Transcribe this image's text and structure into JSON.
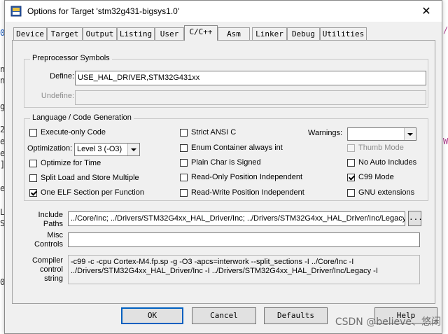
{
  "background_editor": {
    "fragments": [
      {
        "text": "0"
      },
      {
        "text": "ne"
      },
      {
        "text": "ns"
      },
      {
        "text": "g"
      },
      {
        "text": "2"
      },
      {
        "text": "e"
      },
      {
        "text": "e"
      },
      {
        "text": "]"
      },
      {
        "text": "e"
      },
      {
        "text": "L"
      },
      {
        "text": "S"
      },
      {
        "text": "0"
      },
      {
        "text": "/"
      },
      {
        "text": "W"
      }
    ]
  },
  "dialog": {
    "title": "Options for Target 'stm32g431-bigsys1.0'",
    "close_symbol": "✕",
    "accent_color": "#0060c0",
    "tabs": [
      "Device",
      "Target",
      "Output",
      "Listing",
      "User",
      "C/C++",
      "Asm",
      "Linker",
      "Debug",
      "Utilities"
    ],
    "active_tab": "C/C++"
  },
  "preprocessor": {
    "group_label": "Preprocessor Symbols",
    "define_label": "Define:",
    "define_value": "USE_HAL_DRIVER,STM32G431xx",
    "undefine_label": "Undefine:",
    "undefine_value": ""
  },
  "language": {
    "group_label": "Language / Code Generation",
    "execute_only": {
      "label": "Execute-only Code",
      "checked": false
    },
    "optimization_label": "Optimization:",
    "optimization_value": "Level 3 (-O3)",
    "optimize_time": {
      "label": "Optimize for Time",
      "checked": false
    },
    "split_load": {
      "label": "Split Load and Store Multiple",
      "checked": false
    },
    "one_elf": {
      "label": "One ELF Section per Function",
      "checked": true
    },
    "strict_ansi": {
      "label": "Strict ANSI C",
      "checked": false
    },
    "enum_container": {
      "label": "Enum Container always int",
      "checked": false
    },
    "plain_char": {
      "label": "Plain Char is Signed",
      "checked": false
    },
    "ro_pi": {
      "label": "Read-Only Position Independent",
      "checked": false
    },
    "rw_pi": {
      "label": "Read-Write Position Independent",
      "checked": false
    },
    "warnings_label": "Warnings:",
    "warnings_value": "",
    "thumb_mode": {
      "label": "Thumb Mode",
      "checked": false,
      "disabled": true
    },
    "no_auto_includes": {
      "label": "No Auto Includes",
      "checked": false
    },
    "c99_mode": {
      "label": "C99 Mode",
      "checked": true
    },
    "gnu_extensions": {
      "label": "GNU extensions",
      "checked": false
    }
  },
  "include_paths": {
    "label_line1": "Include",
    "label_line2": "Paths",
    "value": "../Core/Inc;            ../Drivers/STM32G4xx_HAL_Driver/Inc;            ../Drivers/STM32G4xx_HAL_Driver/Inc/Legacy",
    "browse_label": "..."
  },
  "misc_controls": {
    "label_line1": "Misc",
    "label_line2": "Controls",
    "value": ""
  },
  "compiler_string": {
    "label_line1": "Compiler",
    "label_line2": "control",
    "label_line3": "string",
    "line1": "-c99 -c -cpu Cortex-M4.fp.sp -g -O3 -apcs=interwork --split_sections -I ../Core/Inc -I",
    "line2": "../Drivers/STM32G4xx_HAL_Driver/Inc -I ../Drivers/STM32G4xx_HAL_Driver/Inc/Legacy -I"
  },
  "buttons": {
    "ok": "OK",
    "cancel": "Cancel",
    "defaults": "Defaults",
    "help": "Help"
  },
  "watermark": "CSDN @believe、悠闲"
}
